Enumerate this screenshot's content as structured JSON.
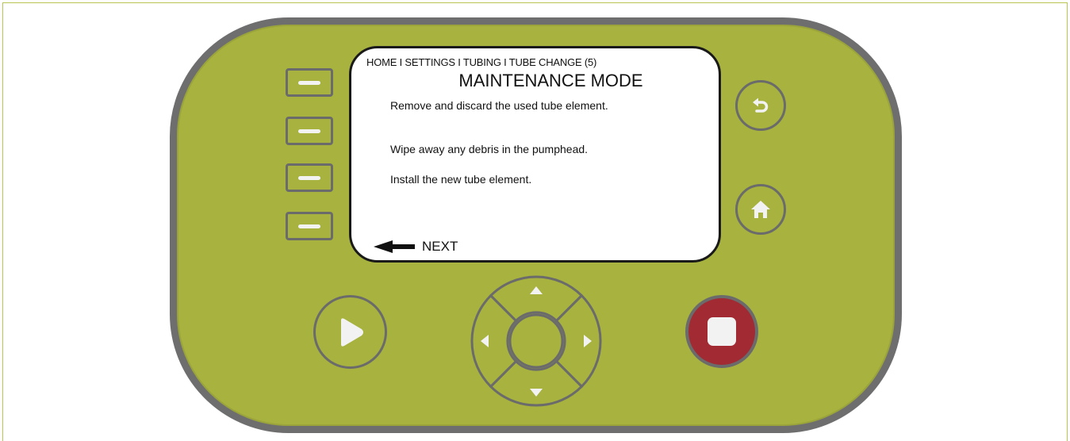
{
  "screen": {
    "breadcrumb": "HOME I SETTINGS I TUBING I TUBE CHANGE (5)",
    "title": "MAINTENANCE MODE",
    "instructions": [
      "Remove and discard the used tube element.",
      "Wipe away any debris in the pumphead.",
      "Install the new tube element."
    ],
    "next_label": "NEXT"
  },
  "colors": {
    "device_body": "#a7b23f",
    "device_border": "#6e6e6e",
    "stop_button": "#a12a33",
    "screen_bg": "#ffffff"
  },
  "icons": {
    "softkeys": [
      "minus-icon",
      "minus-icon",
      "minus-icon",
      "minus-icon"
    ],
    "back": "back-arrow-icon",
    "home": "home-icon",
    "run": "play-icon",
    "stop": "stop-icon",
    "dpad": [
      "up-arrow-icon",
      "down-arrow-icon",
      "left-arrow-icon",
      "right-arrow-icon"
    ],
    "next": "left-arrow-icon"
  }
}
